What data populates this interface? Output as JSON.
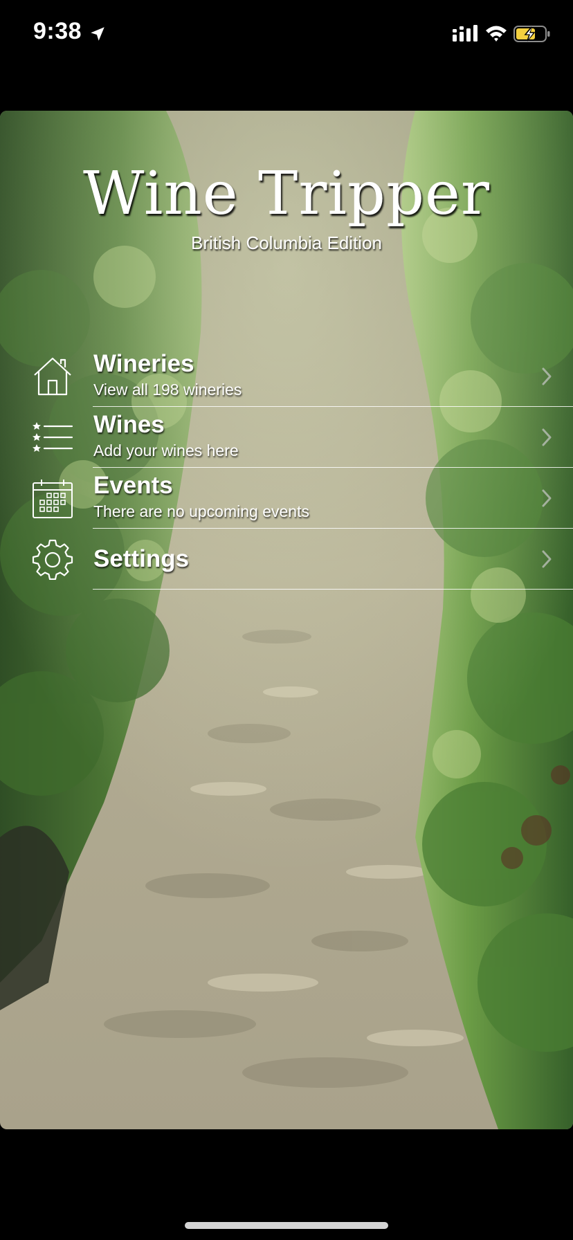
{
  "status_bar": {
    "time": "9:38",
    "icons": [
      "location-arrow-icon",
      "cellular-signal-icon",
      "wifi-icon",
      "battery-charging-icon"
    ],
    "battery_color": "#f4d03f"
  },
  "header": {
    "title": "Wine Tripper",
    "subtitle": "British Columbia Edition"
  },
  "menu": {
    "items": [
      {
        "label": "Wineries",
        "subtitle": "View all 198 wineries",
        "icon": "house-icon"
      },
      {
        "label": "Wines",
        "subtitle": "Add your wines here",
        "icon": "starred-list-icon"
      },
      {
        "label": "Events",
        "subtitle": "There are no upcoming events",
        "icon": "calendar-icon"
      },
      {
        "label": "Settings",
        "subtitle": "",
        "icon": "gear-icon"
      }
    ]
  },
  "background": {
    "image": "vineyard-row-photo",
    "foliage_color": "#5a7f3a",
    "path_color": "#b9b39c"
  }
}
